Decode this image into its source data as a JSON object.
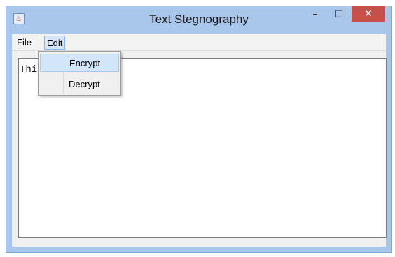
{
  "window": {
    "title": "Text Stegnography",
    "app_icon": "java-icon"
  },
  "titlebar_buttons": {
    "minimize": "–",
    "maximize": "□",
    "close": "✕"
  },
  "menu": {
    "items": [
      {
        "label": "File"
      },
      {
        "label": "Edit"
      }
    ]
  },
  "edit_menu": {
    "options": [
      {
        "label": "Encrypt",
        "state": "hovered"
      },
      {
        "label": "Decrypt"
      }
    ]
  },
  "editor": {
    "visible_text": "Thi         ssage"
  },
  "colors": {
    "title_bar": "#a9c7eb",
    "close_button": "#c7504a",
    "menu_highlight": "#d6e6f8"
  }
}
